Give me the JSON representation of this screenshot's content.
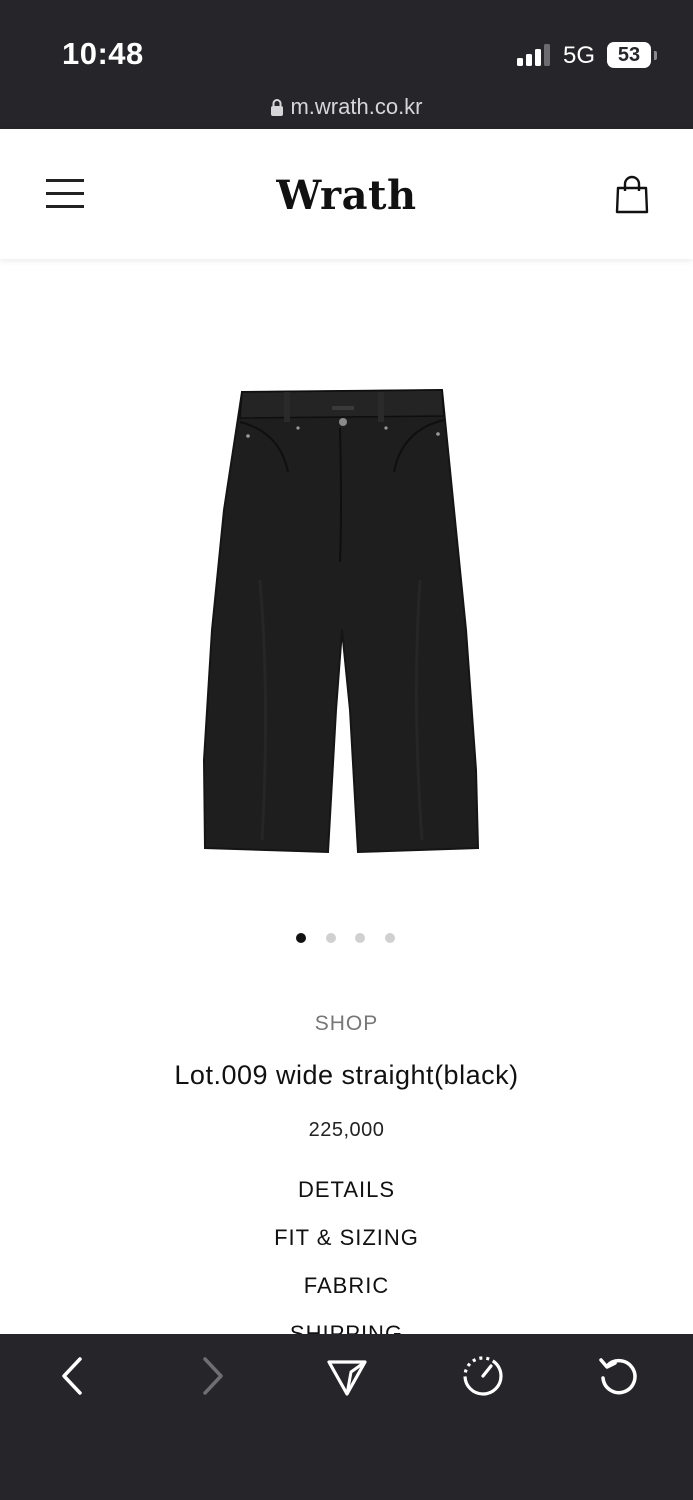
{
  "status_bar": {
    "time": "10:48",
    "network": "5G",
    "battery": "53"
  },
  "browser": {
    "url": "m.wrath.co.kr"
  },
  "header": {
    "logo": "Wrath",
    "menu_icon": "hamburger-menu-icon",
    "cart_icon": "shopping-bag-icon"
  },
  "gallery": {
    "image_count": 4,
    "active_index": 0
  },
  "product": {
    "category": "SHOP",
    "name": "Lot.009 wide straight(black)",
    "price": "225,000"
  },
  "accordion": {
    "details": "DETAILS",
    "fit_sizing": "FIT & SIZING",
    "fabric": "FABRIC",
    "shipping": "SHIPPING"
  },
  "toolbar": {
    "back_icon": "chevron-left-icon",
    "forward_icon": "chevron-right-icon",
    "share_icon": "send-icon",
    "speed_icon": "speedometer-icon",
    "reload_icon": "reload-icon"
  },
  "colors": {
    "chrome_dark": "#25252a",
    "page_bg": "#ffffff",
    "text": "#111111",
    "muted": "#777777"
  }
}
